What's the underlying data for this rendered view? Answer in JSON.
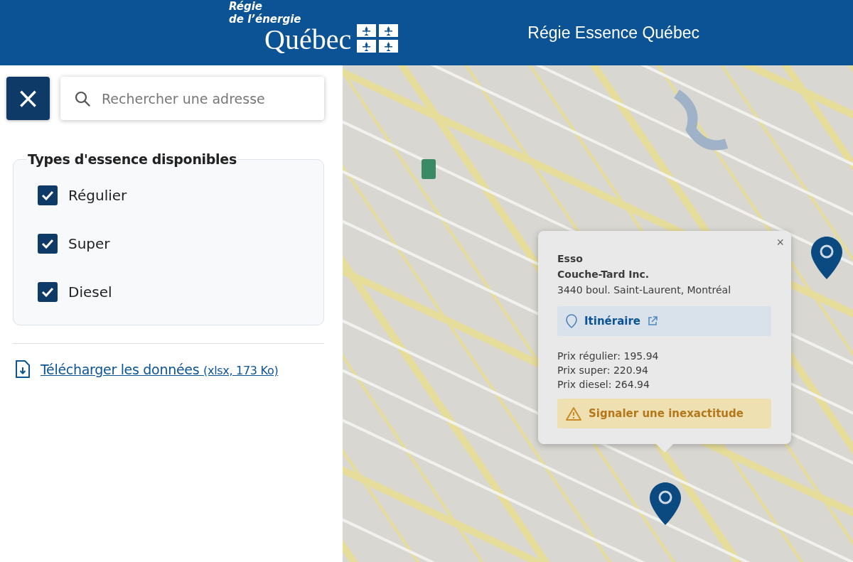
{
  "header": {
    "logo": {
      "line_1": "Régie",
      "line_2": "de l’énergie",
      "line_3": "Québec"
    },
    "title": "Régie Essence Québec"
  },
  "close_button": {
    "label": "×"
  },
  "search": {
    "placeholder": "Rechercher une adresse"
  },
  "filters": {
    "legend": "Types d'essence disponibles",
    "options": [
      {
        "label": "Régulier",
        "checked": true
      },
      {
        "label": "Super",
        "checked": true
      },
      {
        "label": "Diesel",
        "checked": true
      }
    ]
  },
  "download": {
    "link": "Télécharger les données",
    "details": "(xlsx, 173 Ko)"
  },
  "popup": {
    "close": "×",
    "brand": "Esso",
    "company": "Couche-Tard Inc.",
    "address": "3440 boul. Saint-Laurent, Montréal",
    "directions": "Itinéraire",
    "prices": [
      "Prix régulier: 195.94",
      "Prix super: 220.94",
      "Prix diesel: 264.94"
    ],
    "report": "Signaler une inexactitude"
  }
}
